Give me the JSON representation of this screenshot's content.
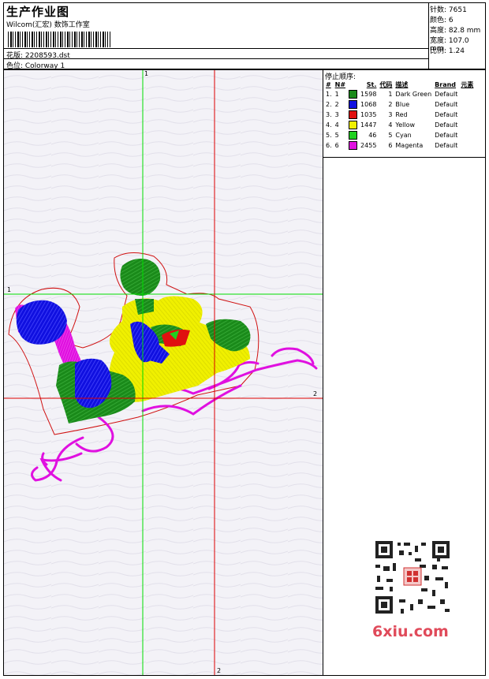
{
  "header": {
    "title": "生产作业图",
    "company": "Wilcom(汇宏) 数饰工作室",
    "design_label": "花版: 2208593.dst",
    "colorway_label": "色位:  Colorway 1",
    "stats": {
      "stitches": "针数: 7651",
      "colors": "颜色: 6",
      "height": "高度: 82.8 mm",
      "width": "宽度: 107.0 mm",
      "scale": "比例: 1.24"
    }
  },
  "stop_sequence": {
    "title": "停止顺序:",
    "columns": [
      "#",
      "N#",
      "St.",
      "代码",
      "描述",
      "Brand",
      "元素"
    ],
    "rows": [
      {
        "idx": "1.",
        "n": "1",
        "color": "#1a8a1a",
        "stitches": "1598",
        "code": "1",
        "desc": "Dark Green",
        "brand": "Default"
      },
      {
        "idx": "2.",
        "n": "2",
        "color": "#1010e0",
        "stitches": "1068",
        "code": "2",
        "desc": "Blue",
        "brand": "Default"
      },
      {
        "idx": "3.",
        "n": "3",
        "color": "#e01010",
        "stitches": "1035",
        "code": "3",
        "desc": "Red",
        "brand": "Default"
      },
      {
        "idx": "4.",
        "n": "4",
        "color": "#f0f000",
        "stitches": "1447",
        "code": "4",
        "desc": "Yellow",
        "brand": "Default"
      },
      {
        "idx": "5.",
        "n": "5",
        "color": "#20d020",
        "stitches": "46",
        "code": "5",
        "desc": "Cyan",
        "brand": "Default"
      },
      {
        "idx": "6.",
        "n": "6",
        "color": "#e010e0",
        "stitches": "2455",
        "code": "6",
        "desc": "Magenta",
        "brand": "Default"
      }
    ]
  },
  "canvas": {
    "axis_labels": {
      "v1": "1",
      "h1": "1",
      "h2": "2",
      "v2": "2"
    }
  },
  "watermark": {
    "text": "6xiu.com"
  },
  "colors": {
    "green_axis": "#00dd00",
    "red_axis": "#dd0000",
    "canvas_bg": "#f3f2f7"
  }
}
